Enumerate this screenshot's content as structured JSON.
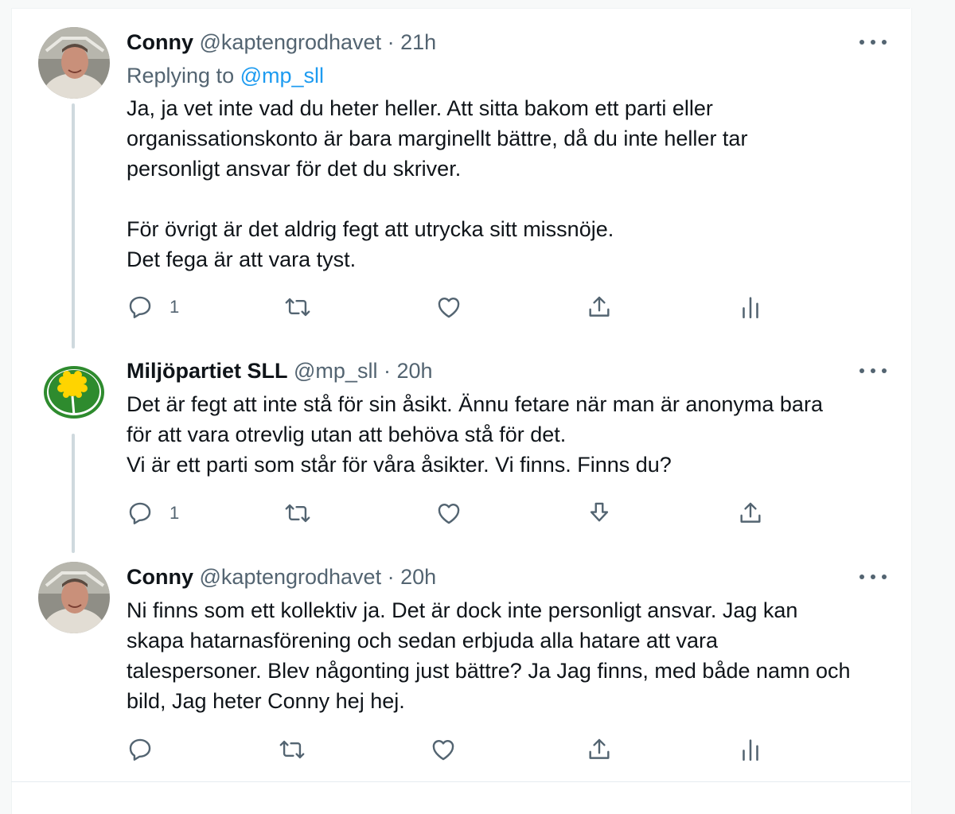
{
  "tweets": [
    {
      "name": "Conny",
      "handle": "@kaptengrodhavet",
      "separator": "·",
      "time": "21h",
      "replying_prefix": "Replying to",
      "replying_mention": "@mp_sll",
      "text": "Ja, ja vet inte vad du heter heller. Att sitta bakom ett parti eller\norganissationskonto är bara marginellt bättre, då du inte heller tar\npersonligt ansvar för det du skriver.\n\nFör övrigt är det aldrig fegt att utrycka sitt missnöje.\nDet fega är att vara tyst.",
      "reply_count": "1",
      "actions": [
        "reply-icon",
        "retweet-icon",
        "like-icon",
        "share-icon",
        "analytics-icon"
      ]
    },
    {
      "name": "Miljöpartiet SLL",
      "handle": "@mp_sll",
      "separator": "·",
      "time": "20h",
      "text": "Det är fegt att inte stå för sin åsikt. Ännu fetare när man är anonyma bara\nför att vara otrevlig utan att behöva stå för det.\nVi är ett parti som står för våra åsikter. Vi finns. Finns du?",
      "reply_count": "1",
      "actions": [
        "reply-icon",
        "retweet-icon",
        "like-icon",
        "download-icon",
        "share-icon"
      ]
    },
    {
      "name": "Conny",
      "handle": "@kaptengrodhavet",
      "separator": "·",
      "time": "20h",
      "text": "Ni finns som ett kollektiv ja. Det är dock inte personligt ansvar. Jag kan\nskapa hatarnasförening och sedan erbjuda alla hatare att vara\ntalespersoner. Blev någonting just bättre? Ja Jag finns, med både namn och\nbild,  Jag heter Conny hej hej.",
      "actions": [
        "reply-icon",
        "retweet-icon",
        "like-icon",
        "share-icon",
        "analytics-icon"
      ]
    }
  ],
  "colors": {
    "text": "#0f1419",
    "secondary": "#536471",
    "link": "#1d9bf0",
    "thread_line": "#cfd9de",
    "party_green": "#2e8b2e",
    "dandelion": "#ffd400"
  }
}
